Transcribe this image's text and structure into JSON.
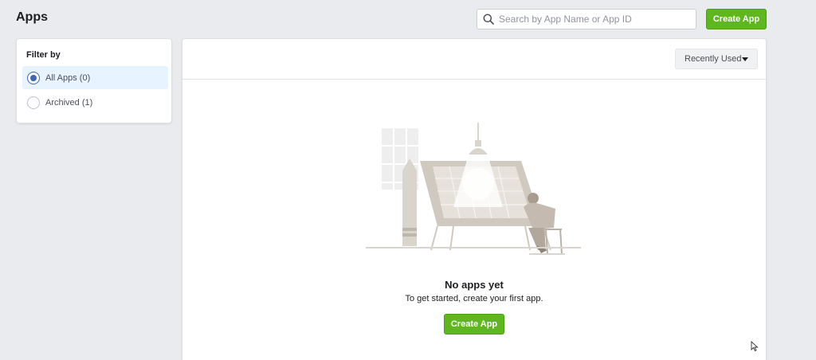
{
  "header": {
    "title": "Apps",
    "search_placeholder": "Search by App Name or App ID",
    "create_label": "Create App"
  },
  "filter": {
    "title": "Filter by",
    "options": [
      {
        "label": "All Apps (0)",
        "selected": true
      },
      {
        "label": "Archived (1)",
        "selected": false
      }
    ]
  },
  "main": {
    "sort_label": "Recently Used",
    "empty_title": "No apps yet",
    "empty_subtitle": "To get started, create your first app.",
    "create_label": "Create App"
  },
  "colors": {
    "accent_green": "#5fb71f",
    "radio_blue": "#4267b2",
    "background": "#e9ebee"
  },
  "icons": [
    "search-icon",
    "chevron-down-icon",
    "empty-state-illustration",
    "mouse-cursor-icon"
  ]
}
